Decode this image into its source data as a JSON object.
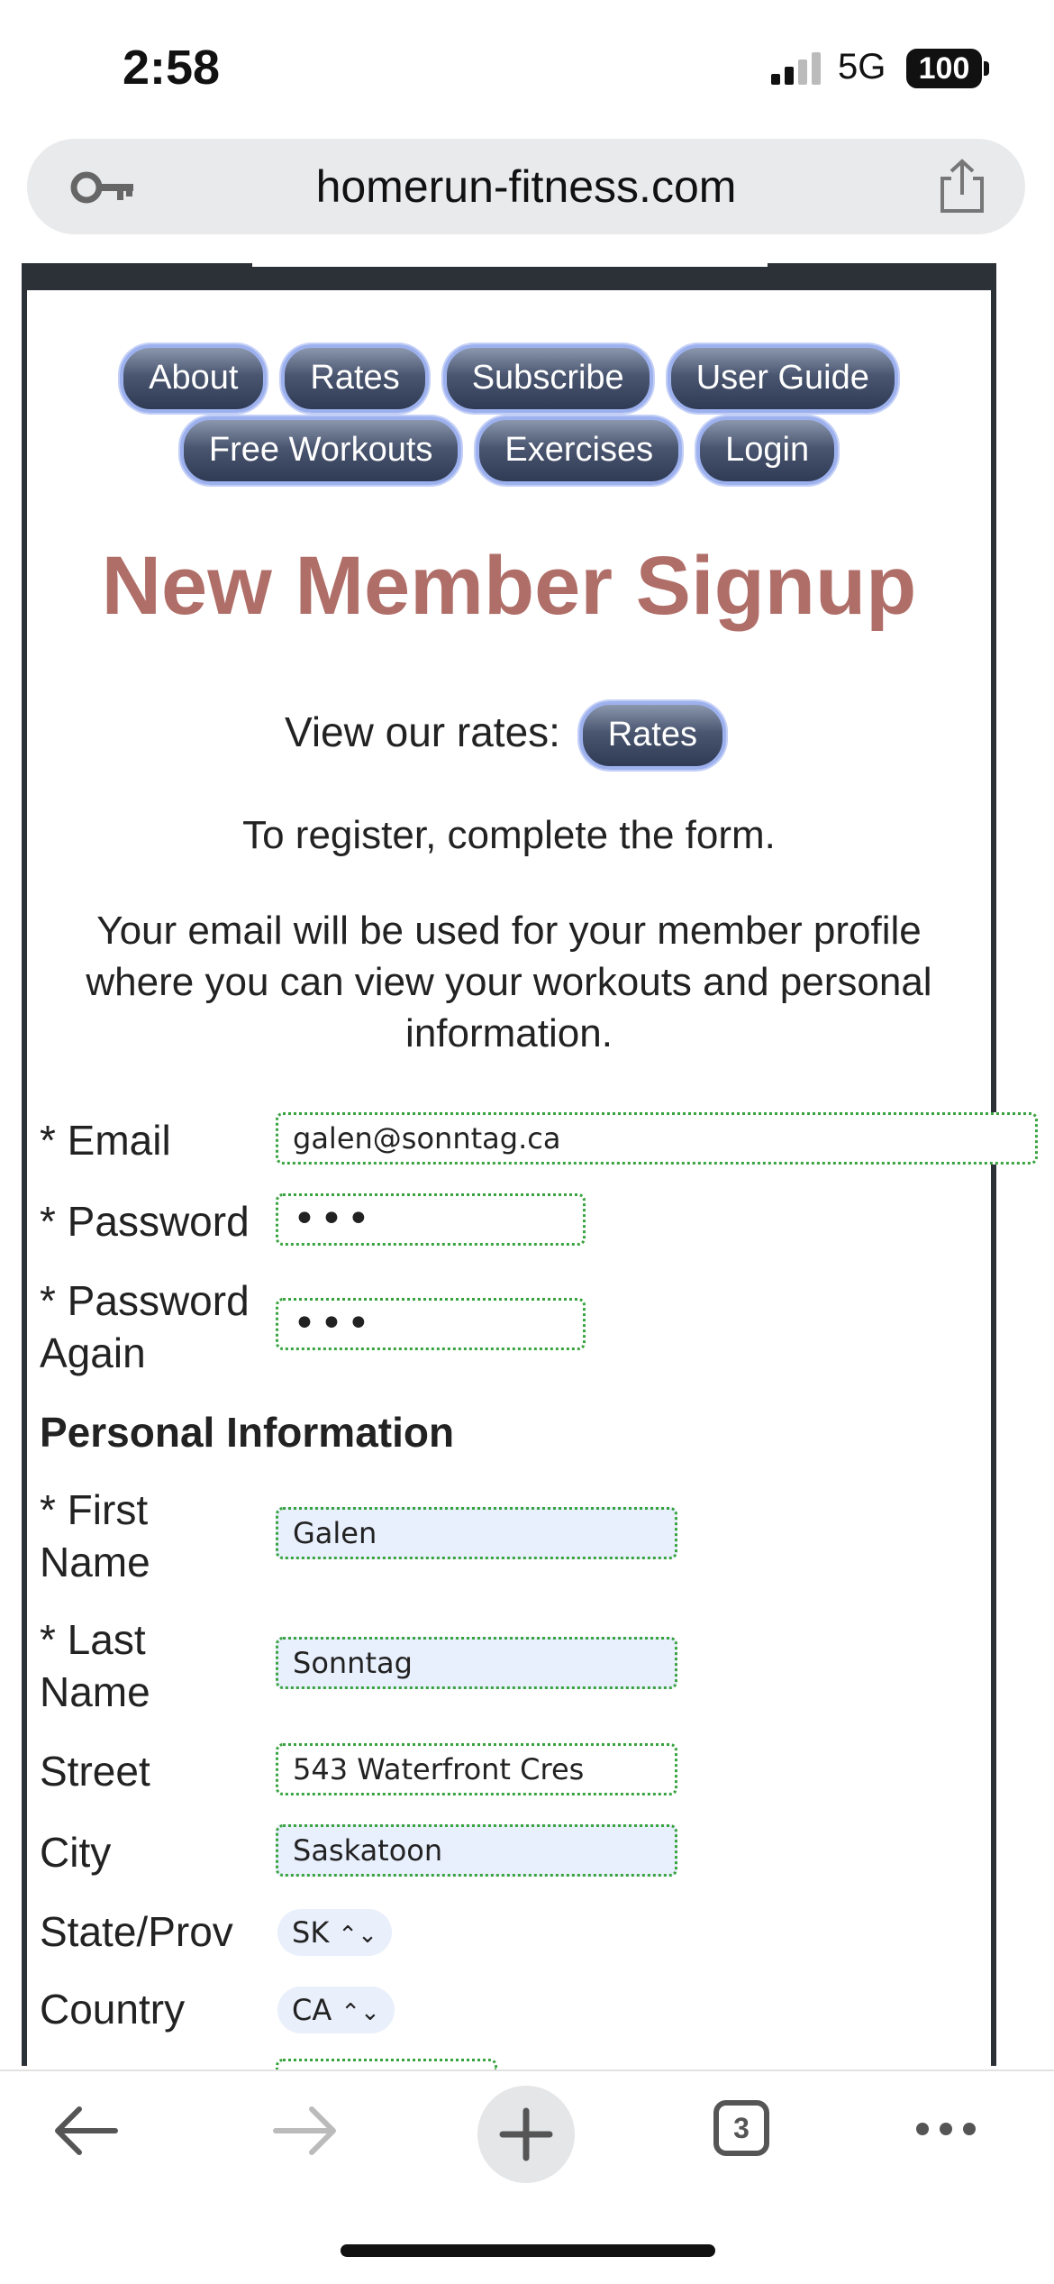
{
  "status_bar": {
    "time": "2:58",
    "network": "5G",
    "battery": "100"
  },
  "browser": {
    "url": "homerun-fitness.com",
    "tab_count": "3"
  },
  "nav": {
    "row1": [
      "About",
      "Rates",
      "Subscribe",
      "User Guide"
    ],
    "row2": [
      "Free Workouts",
      "Exercises",
      "Login"
    ]
  },
  "page": {
    "title": "New Member Signup",
    "view_rates_text": "View our rates:",
    "view_rates_button": "Rates",
    "register_text": "To register, complete the form.",
    "email_note": "Your email will be used for your member profile where you can view your workouts and personal information."
  },
  "form": {
    "email_label": "* Email",
    "email_value": "galen@sonntag.ca",
    "password_label": "* Password",
    "password_value": "•••",
    "password_again_label_1": "* Password",
    "password_again_label_2": "Again",
    "password_again_value": "•••",
    "section_personal": "Personal Information",
    "first_name_label_1": "* First",
    "first_name_label_2": "Name",
    "first_name_value": "Galen",
    "last_name_label_1": "* Last",
    "last_name_label_2": "Name",
    "last_name_value": "Sonntag",
    "street_label": "Street",
    "street_value": "543 Waterfront Cres",
    "city_label": "City",
    "city_value": "Saskatoon",
    "state_label": "State/Prov",
    "state_value": "SK",
    "country_label": "Country",
    "country_value": "CA"
  },
  "icons": {
    "key": "key-icon",
    "share": "share-icon",
    "back": "back-arrow-icon",
    "forward": "forward-arrow-icon",
    "new_tab": "plus-icon",
    "tabs": "tabs-icon",
    "more": "more-icon"
  },
  "colors": {
    "title": "#b06e68",
    "pill_border": "#9db1ee",
    "field_border": "#39a33f",
    "autofill_bg": "#e8effd"
  }
}
